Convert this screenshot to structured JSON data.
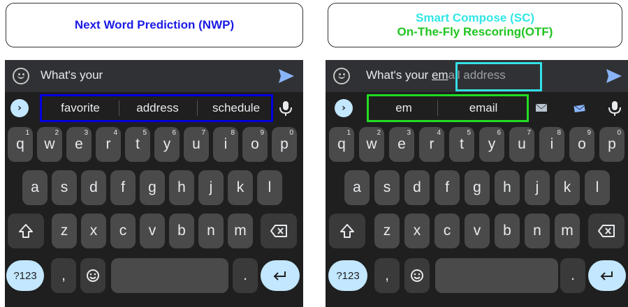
{
  "left_caption": {
    "line1": "Next Word Prediction (NWP)",
    "line1_color": "#1a1ae6"
  },
  "right_caption": {
    "line1": "Smart Compose (SC)",
    "line1_color": "#33e6e6",
    "line2": "On-The-Fly Rescoring(OTF)",
    "line2_color": "#1fc41f"
  },
  "left_keyboard": {
    "input_text": "What's your",
    "suggestions": [
      "favorite",
      "address",
      "schedule"
    ],
    "highlight_color": "#0000e0"
  },
  "right_keyboard": {
    "input_prefix": "What's your ",
    "input_typed": "em",
    "input_ghost": "ail address",
    "suggestions": [
      "em",
      "email"
    ],
    "sc_highlight_color": "#33e0e8",
    "otf_highlight_color": "#22dd22"
  },
  "keys": {
    "row1": [
      {
        "k": "q",
        "h": "1"
      },
      {
        "k": "w",
        "h": "2"
      },
      {
        "k": "e",
        "h": "3"
      },
      {
        "k": "r",
        "h": "4"
      },
      {
        "k": "t",
        "h": "5"
      },
      {
        "k": "y",
        "h": "6"
      },
      {
        "k": "u",
        "h": "7"
      },
      {
        "k": "i",
        "h": "8"
      },
      {
        "k": "o",
        "h": "9"
      },
      {
        "k": "p",
        "h": "0"
      }
    ],
    "row2": [
      "a",
      "s",
      "d",
      "f",
      "g",
      "h",
      "j",
      "k",
      "l"
    ],
    "row3": [
      "z",
      "x",
      "c",
      "v",
      "b",
      "n",
      "m"
    ],
    "symbols": "?123",
    "comma": ",",
    "period": "."
  },
  "icons": {
    "emoji": "smiley-icon",
    "send": "send-arrow-icon",
    "chevron": "chevron-right-icon",
    "mic": "mic-icon",
    "shift": "shift-arrow-icon",
    "backspace": "backspace-icon",
    "enter": "enter-return-icon",
    "mail": "envelope-icon"
  }
}
